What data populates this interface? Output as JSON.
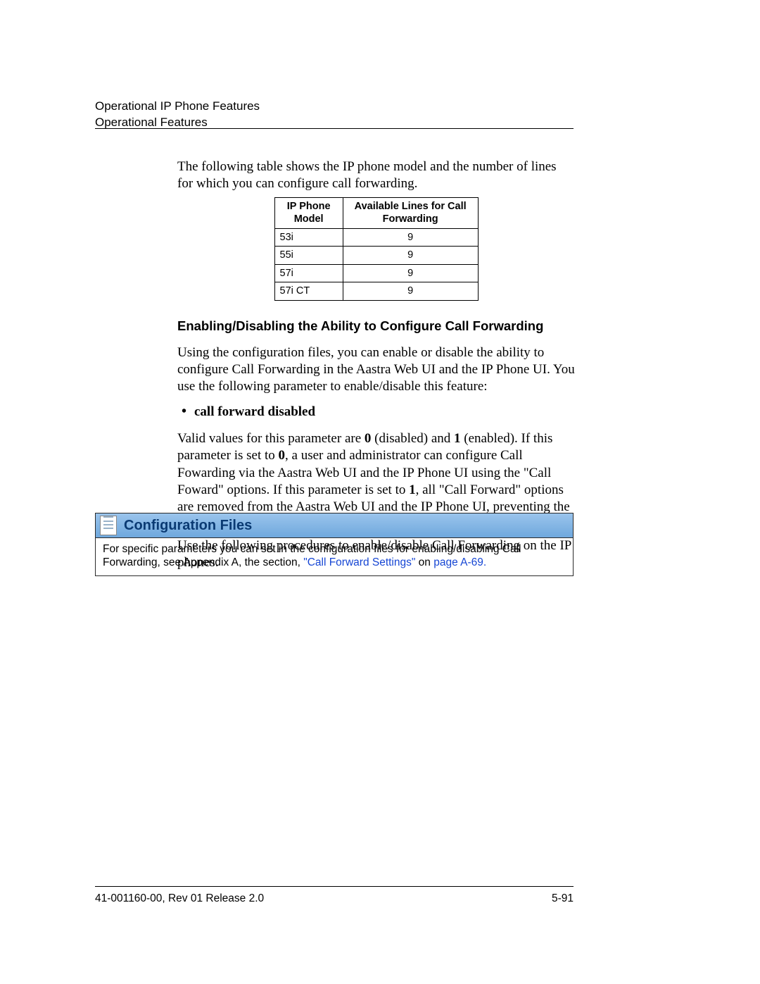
{
  "header": {
    "line1": "Operational IP Phone Features",
    "line2": "Operational Features"
  },
  "side_caption": "Operational IP Phone Features",
  "intro": "The following table shows the IP phone model and the number of lines for which you can configure call forwarding.",
  "table": {
    "head_model": "IP Phone Model",
    "head_lines": "Available Lines for Call Forwarding",
    "rows": [
      {
        "model": "53i",
        "lines": "9"
      },
      {
        "model": "55i",
        "lines": "9"
      },
      {
        "model": "57i",
        "lines": "9"
      },
      {
        "model": "57i CT",
        "lines": "9"
      }
    ]
  },
  "section_heading": "Enabling/Disabling the Ability to Configure Call Forwarding",
  "para_after_heading": "Using the configuration files, you can enable or disable the ability to configure Call Forwarding in the Aastra Web UI and the IP Phone UI. You use the following parameter to enable/disable this feature:",
  "bullet": "call forward disabled",
  "valid_values": {
    "pre1": "Valid values for this parameter are ",
    "b1": "0",
    "mid1": " (disabled) and ",
    "b2": "1",
    "mid2": " (enabled). If this parameter is set to ",
    "b3": "0",
    "mid3": ", a user and administrator can configure Call Fowarding via the Aastra Web UI and the IP Phone UI using the \"Call Foward\" options. If this parameter is set to ",
    "b4": "1",
    "post": ", all \"Call Forward\" options are removed from the Aastra Web UI and the IP Phone UI, preventing the ability to configure Call Fowarding."
  },
  "use_procedures": "Use the following procedures to enable/disable Call Forwarding on the IP phones.",
  "config_box": {
    "title": "Configuration Files",
    "body_pre": "For specific parameters you can set in the configuration files for enabling/disabling Call Forwarding, see Appendix A, the section, ",
    "link1": "\"Call Forward Settings\"",
    "body_mid": " on ",
    "link2": "page A-69.",
    "body_post": ""
  },
  "footer": {
    "left": "41-001160-00, Rev 01  Release 2.0",
    "right": "5-91"
  }
}
